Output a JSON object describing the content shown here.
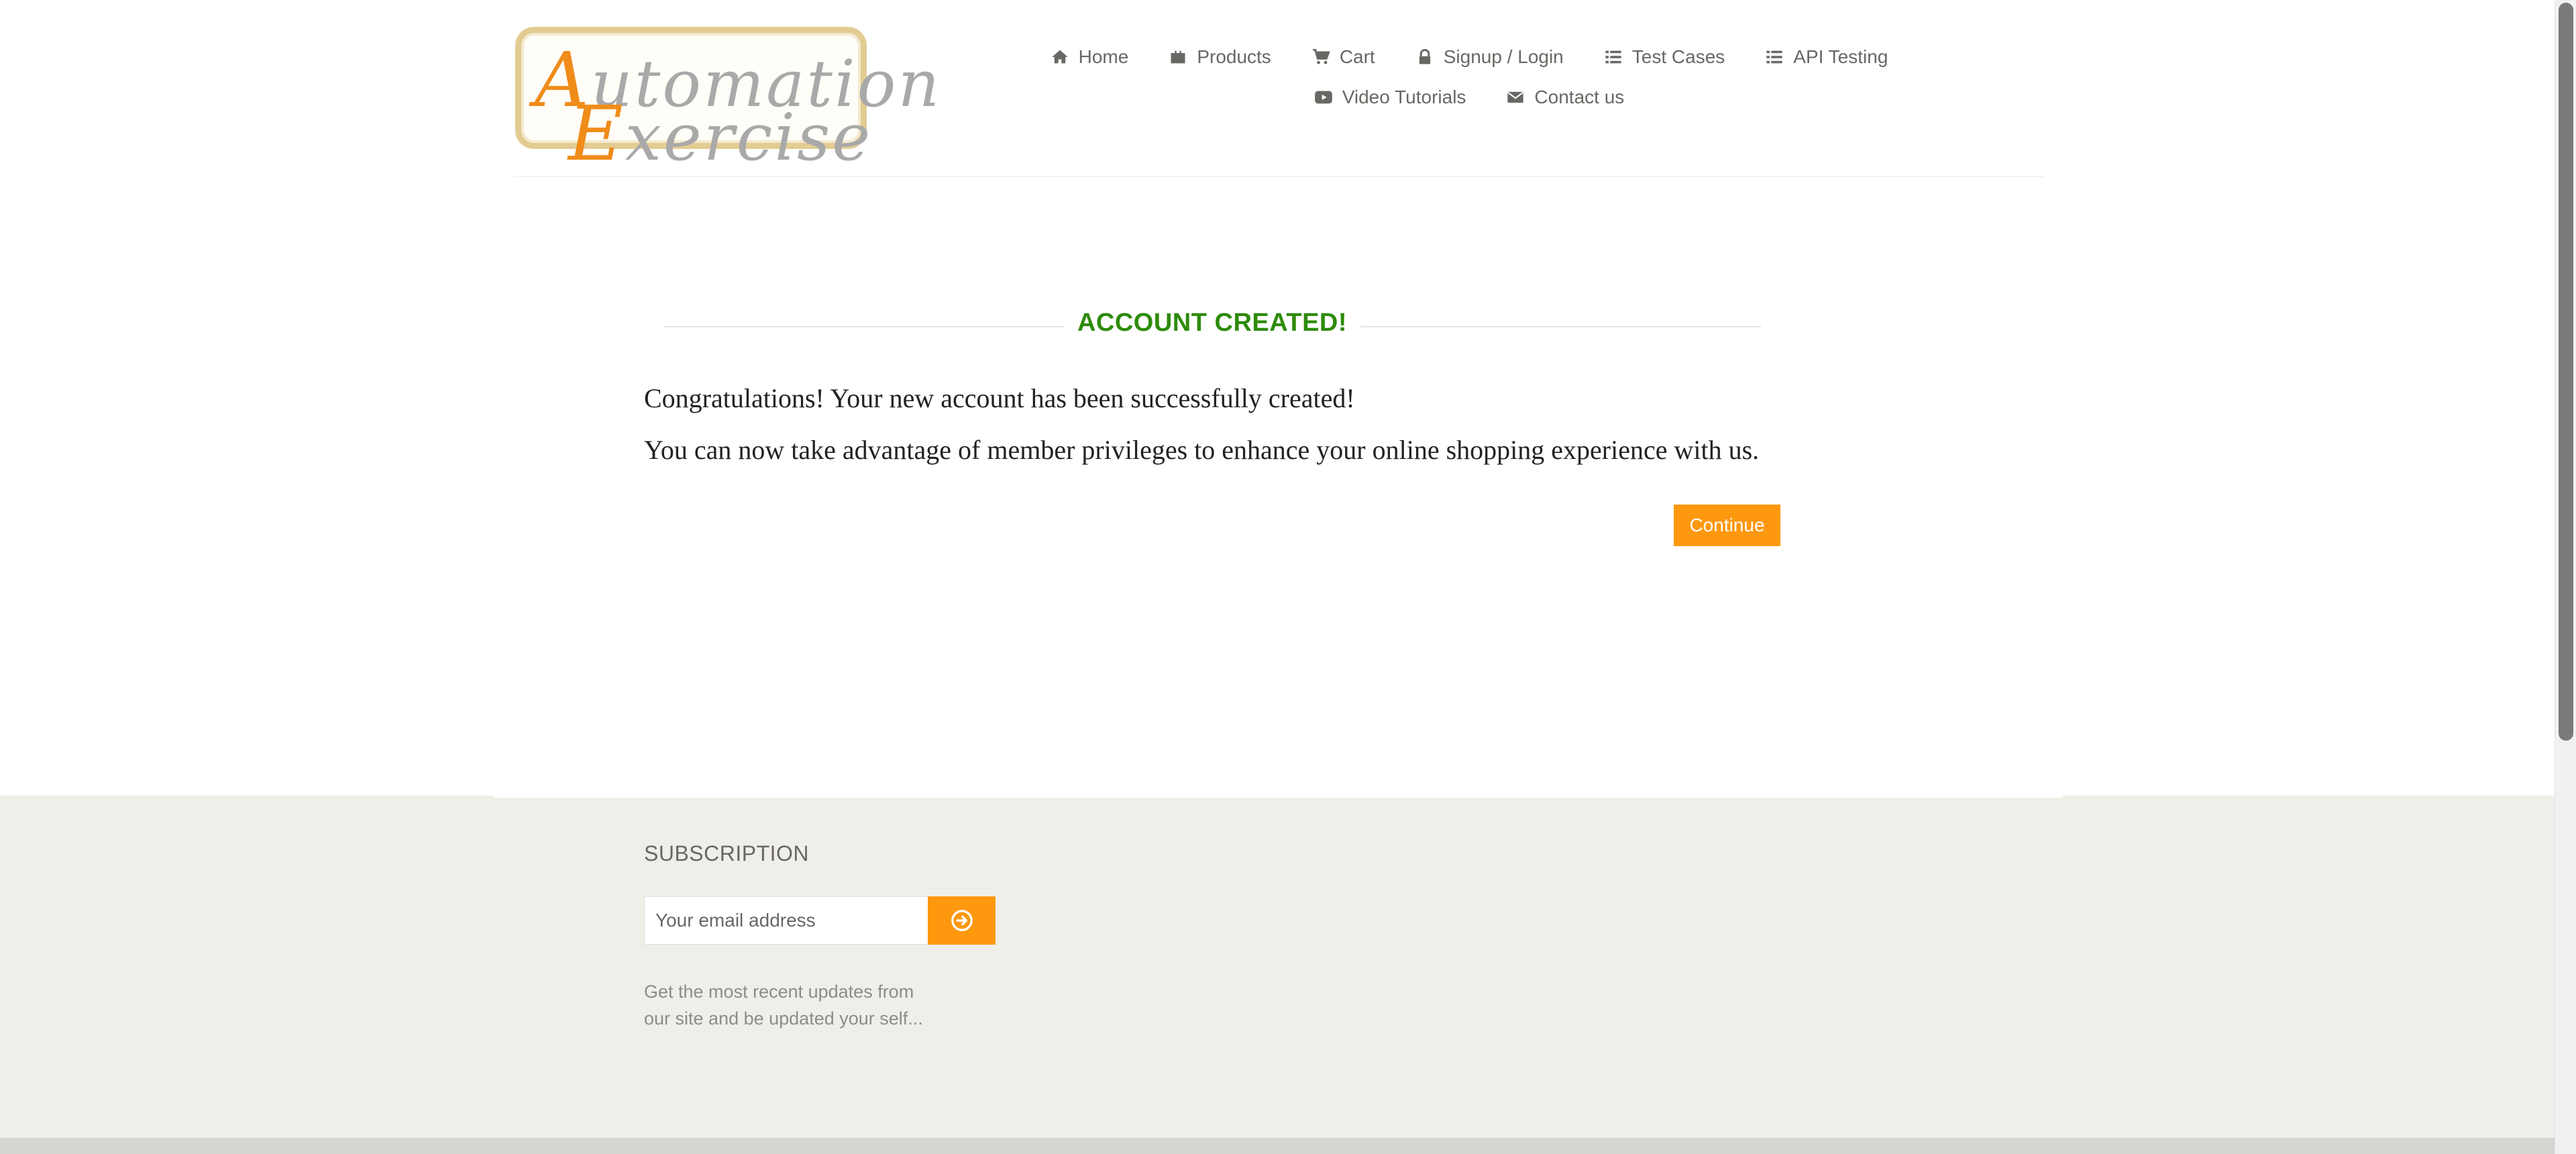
{
  "header": {
    "logo": {
      "line1_cap": "A",
      "line1_rest": "utomation",
      "line2_cap": "E",
      "line2_rest": "xercise"
    },
    "nav_row1": [
      {
        "label": "Home",
        "icon": "home-icon"
      },
      {
        "label": "Products",
        "icon": "products-icon"
      },
      {
        "label": "Cart",
        "icon": "cart-icon"
      },
      {
        "label": "Signup / Login",
        "icon": "lock-icon"
      },
      {
        "label": "Test Cases",
        "icon": "list-icon"
      },
      {
        "label": "API Testing",
        "icon": "list-icon"
      }
    ],
    "nav_row2": [
      {
        "label": "Video Tutorials",
        "icon": "youtube-play-icon"
      },
      {
        "label": "Contact us",
        "icon": "envelope-icon"
      }
    ]
  },
  "main": {
    "title": "ACCOUNT CREATED!",
    "message1": "Congratulations! Your new account has been successfully created!",
    "message2": "You can now take advantage of member privileges to enhance your online shopping experience with us.",
    "continue_label": "Continue"
  },
  "footer": {
    "subscription_title": "SUBSCRIPTION",
    "email_placeholder": "Your email address",
    "subscribe_icon": "arrow-circle-right-icon",
    "description_line1": "Get the most recent updates from",
    "description_line2": "our site and be updated your self..."
  },
  "colors": {
    "accent": "#fe980f",
    "success": "#2e8b0a",
    "nav_text": "#696763",
    "footer_bg": "#efeee8"
  }
}
